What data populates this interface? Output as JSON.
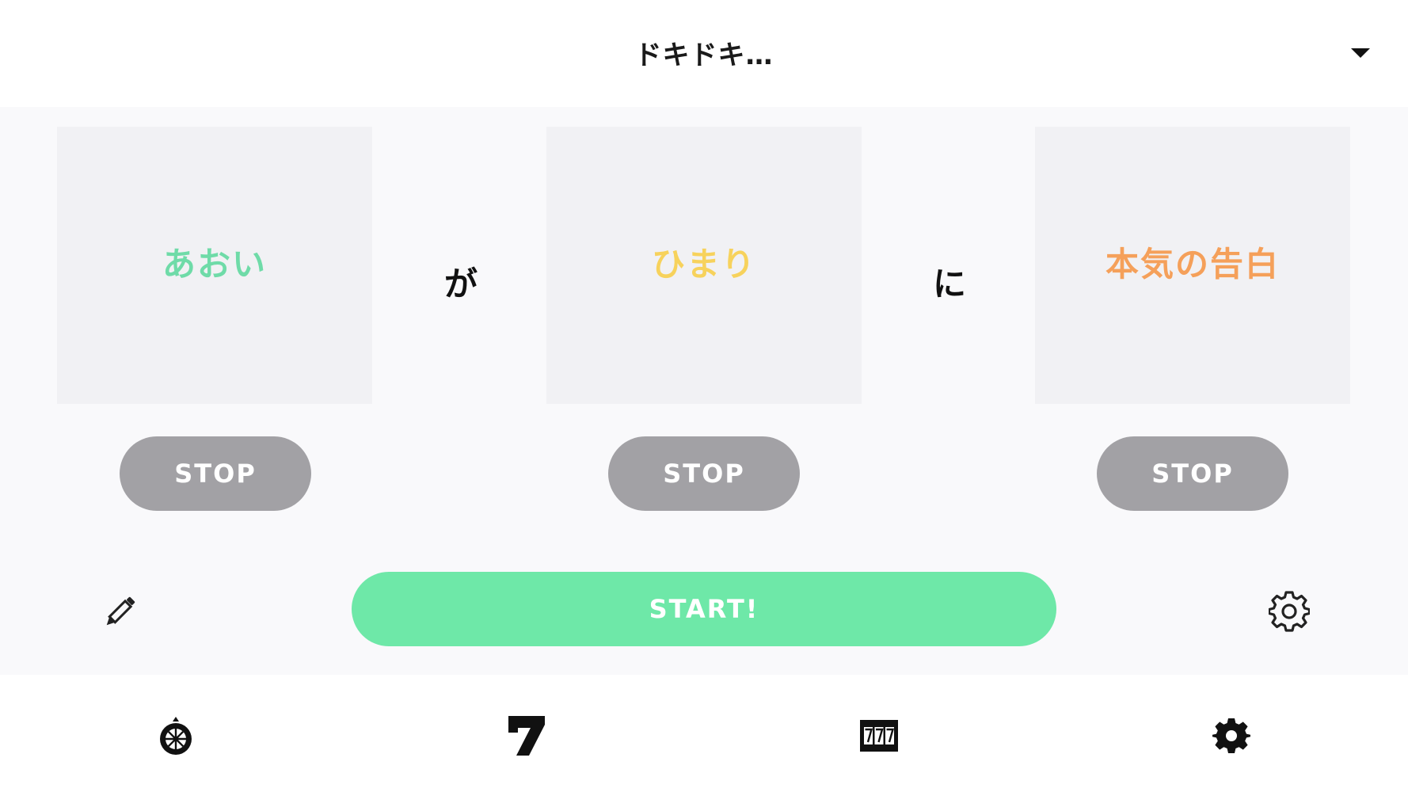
{
  "header": {
    "title": "ドキドキ…",
    "dropdown_icon": "caret-down-icon"
  },
  "reels": [
    {
      "text": "あおい",
      "color": "#6fdba8"
    },
    {
      "text": "ひまり",
      "color": "#f7d25c"
    },
    {
      "text": "本気の告白",
      "color": "#f5a05a"
    }
  ],
  "particles": [
    "が",
    "に"
  ],
  "stop_buttons": [
    "STOP",
    "STOP",
    "STOP"
  ],
  "start_button": {
    "label": "START!",
    "color": "#6ee8a8"
  },
  "controls": {
    "edit_icon": "pencil-icon",
    "settings_icon": "gear-outline-icon"
  },
  "tabbar": {
    "tabs": [
      {
        "icon": "roulette-wheel-icon"
      },
      {
        "icon": "lucky-seven-icon",
        "label": "7"
      },
      {
        "icon": "slot-machine-icon",
        "label": "777"
      },
      {
        "icon": "gear-icon"
      }
    ]
  },
  "colors": {
    "stop_button": "#a2a1a5",
    "reel_background": "#f1f1f4",
    "page_background": "#f9f9fb"
  }
}
